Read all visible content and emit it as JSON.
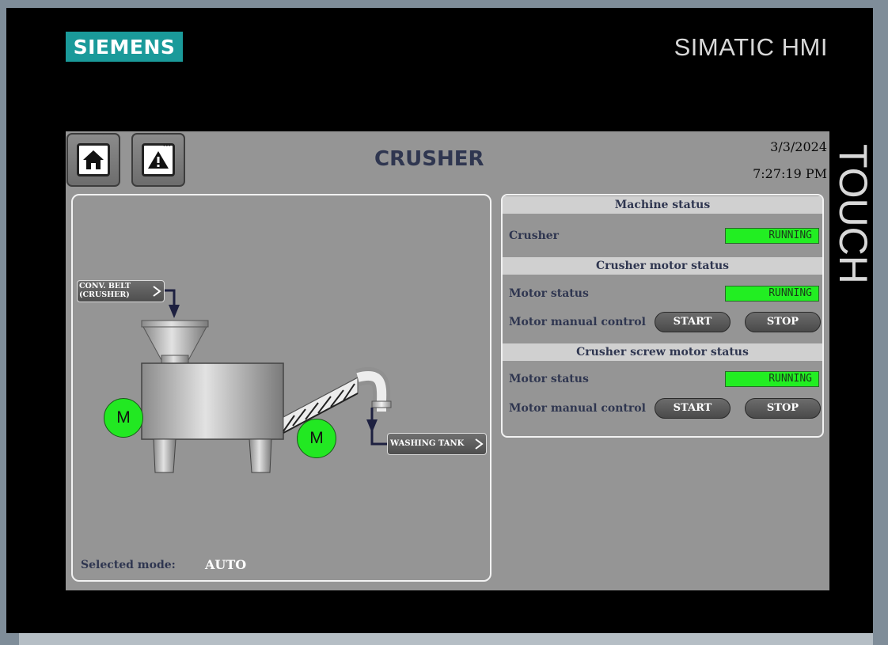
{
  "brand": {
    "logo": "SIEMENS",
    "product": "SIMATIC HMI",
    "vertical": "TOUCH"
  },
  "header": {
    "title": "CRUSHER",
    "date": "3/3/2024",
    "time": "7:27:19 PM"
  },
  "nav": {
    "home_icon": "home-icon",
    "alarm_icon": "alarm-warning-icon"
  },
  "process": {
    "inlet_label_line1": "CONV. BELT",
    "inlet_label_line2": "(CRUSHER)",
    "outlet_label": "WASHING TANK",
    "motor1_label": "M",
    "motor2_label": "M",
    "mode_label": "Selected mode:",
    "mode_value": "AUTO"
  },
  "status": {
    "machine": {
      "header": "Machine status",
      "crusher_label": "Crusher",
      "crusher_state": "RUNNING"
    },
    "crusher_motor": {
      "header": "Crusher motor status",
      "status_label": "Motor status",
      "status_value": "RUNNING",
      "control_label": "Motor manual control",
      "start_label": "START",
      "stop_label": "STOP"
    },
    "screw_motor": {
      "header": "Crusher screw motor status",
      "status_label": "Motor status",
      "status_value": "RUNNING",
      "control_label": "Motor manual control",
      "start_label": "START",
      "stop_label": "STOP"
    }
  },
  "colors": {
    "running": "#22ee22",
    "screen_bg": "#959595",
    "title": "#2f3650",
    "brand_teal": "#1a9a9a"
  }
}
